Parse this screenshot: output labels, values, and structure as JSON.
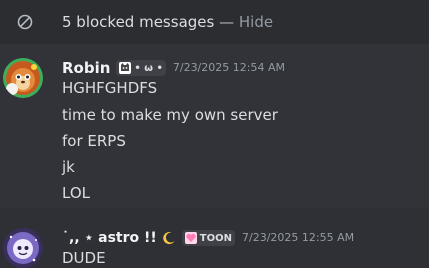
{
  "blocked": {
    "icon": "blocked-icon",
    "text": "5 blocked messages",
    "separator": "—",
    "hide_label": "Hide"
  },
  "messages": [
    {
      "username": "Robin",
      "tag": "• ω •",
      "tag_icon": "cat-face-icon",
      "timestamp": "7/23/2025 12:54 AM",
      "lines": [
        "HGHFGHDFS",
        "time to make my own server",
        "for ERPS",
        "jk",
        "LOL"
      ]
    },
    {
      "username": "˙,, ⋆ astro !!",
      "tag": "TOON",
      "tag_icon": "heart-icon",
      "timestamp": "7/23/2025 12:55 AM",
      "lines": [
        "DUDE"
      ]
    }
  ],
  "colors": {
    "background": "#313338",
    "blocked_bar": "#2b2d31",
    "username": "#f2f3f5",
    "timestamp": "#949ba4",
    "text": "#dbdee1",
    "tag_heart": "#ff7eb9"
  }
}
